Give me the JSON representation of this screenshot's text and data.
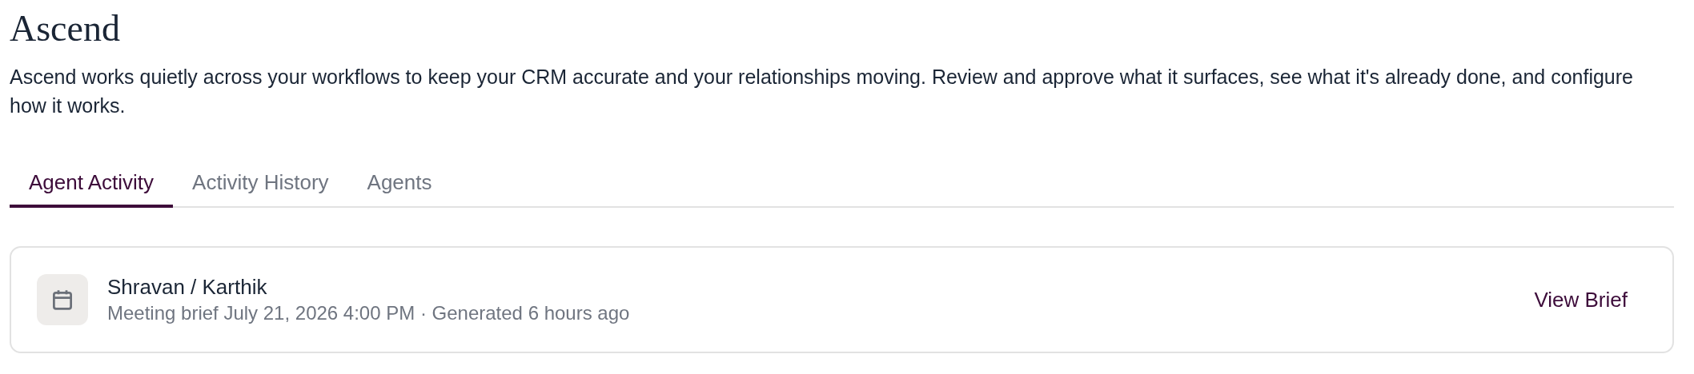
{
  "title": "Ascend",
  "description": "Ascend works quietly across your workflows to keep your CRM accurate and your relationships moving. Review and approve what it surfaces, see what it's already done, and configure how it works.",
  "tabs": [
    {
      "label": "Agent Activity",
      "selected": true
    },
    {
      "label": "Activity History",
      "selected": false
    },
    {
      "label": "Agents",
      "selected": false
    }
  ],
  "activity_items": [
    {
      "title": "Shravan / Karthik",
      "subtitle": "Meeting brief July 21, 2026 4:00 PM · Generated 6 hours ago",
      "action": "View Brief"
    }
  ]
}
